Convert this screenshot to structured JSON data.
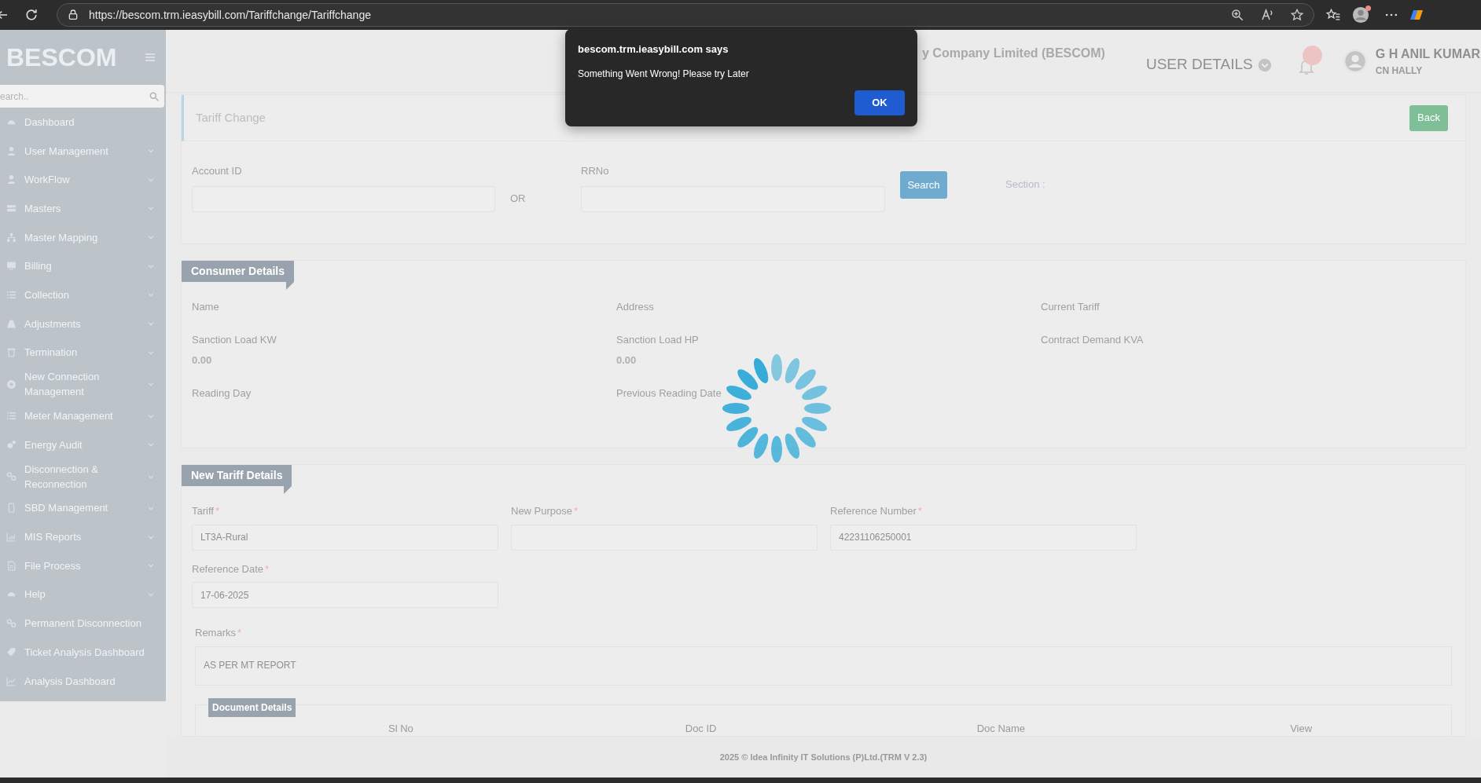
{
  "browser": {
    "url": "https://bescom.trm.ieasybill.com/Tariffchange/Tariffchange"
  },
  "sidebar": {
    "brand": "BESCOM",
    "search_placeholder": "earch..",
    "items": [
      {
        "label": "Dashboard",
        "kind": "gauge",
        "submenu": false
      },
      {
        "label": "User Management",
        "kind": "user",
        "submenu": true
      },
      {
        "label": "WorkFlow",
        "kind": "user",
        "submenu": true
      },
      {
        "label": "Masters",
        "kind": "server",
        "submenu": true
      },
      {
        "label": "Master Mapping",
        "kind": "sitemap",
        "submenu": true
      },
      {
        "label": "Billing",
        "kind": "monitor",
        "submenu": true
      },
      {
        "label": "Collection",
        "kind": "list",
        "submenu": true
      },
      {
        "label": "Adjustments",
        "kind": "road",
        "submenu": true
      },
      {
        "label": "Termination",
        "kind": "trash",
        "submenu": true
      },
      {
        "label": "New Connection Management",
        "kind": "plus",
        "submenu": true
      },
      {
        "label": "Meter Management",
        "kind": "list",
        "submenu": true
      },
      {
        "label": "Energy Audit",
        "kind": "gears",
        "submenu": true
      },
      {
        "label": "Disconnection & Reconnection",
        "kind": "link",
        "submenu": true
      },
      {
        "label": "SBD Management",
        "kind": "mobile",
        "submenu": true
      },
      {
        "label": "MIS Reports",
        "kind": "chart",
        "submenu": true
      },
      {
        "label": "File Process",
        "kind": "file",
        "submenu": true
      },
      {
        "label": "Help",
        "kind": "gauge",
        "submenu": true
      },
      {
        "label": "Permanent Disconnection",
        "kind": "link",
        "submenu": false
      },
      {
        "label": "Ticket Analysis Dashboard",
        "kind": "tag",
        "submenu": false
      },
      {
        "label": "Analysis Dashboard",
        "kind": "linechart",
        "submenu": false
      }
    ]
  },
  "header": {
    "title": "y Company Limited (BESCOM)",
    "user_details": "USER DETAILS",
    "user_name": "G H ANIL KUMAR",
    "user_location": "CN HALLY"
  },
  "page": {
    "title": "Tariff Change",
    "back_button": "Back"
  },
  "search_form": {
    "account_label": "Account ID",
    "or_text": "OR",
    "rrno_label": "RRNo",
    "search_button": "Search",
    "section_label": "Section :"
  },
  "consumer_details": {
    "heading": "Consumer Details",
    "fields": [
      {
        "label": "Name"
      },
      {
        "label": "Address"
      },
      {
        "label": "Current Tariff"
      },
      {
        "label": "Sanction Load KW",
        "value": "0.00"
      },
      {
        "label": "Sanction Load HP",
        "value": "0.00"
      },
      {
        "label": "Contract Demand KVA"
      },
      {
        "label": "Reading Day"
      },
      {
        "label": "Previous Reading Date"
      }
    ]
  },
  "new_tariff": {
    "heading": "New Tariff Details",
    "fields": [
      {
        "label": "Tariff",
        "required": "*",
        "value": "LT3A-Rural"
      },
      {
        "label": "New Purpose",
        "required": "*"
      },
      {
        "label": "Reference Number",
        "required": "*",
        "value": "42231106250001"
      },
      {
        "label": "Reference Date",
        "required": "*",
        "value": "17-06-2025"
      }
    ],
    "remarks": {
      "label": "Remarks",
      "required": "*",
      "value": "AS PER MT REPORT"
    },
    "documents": {
      "heading": "Document Details",
      "columns": [
        "Sl No",
        "Doc ID",
        "Doc Name",
        "View"
      ]
    }
  },
  "footer": "2025 © Idea Infinity IT Solutions (P)Ltd.(TRM V 2.3)",
  "dialog": {
    "title": "bescom.trm.ieasybill.com says",
    "message": "Something Went Wrong! Please try Later",
    "button": "OK"
  }
}
